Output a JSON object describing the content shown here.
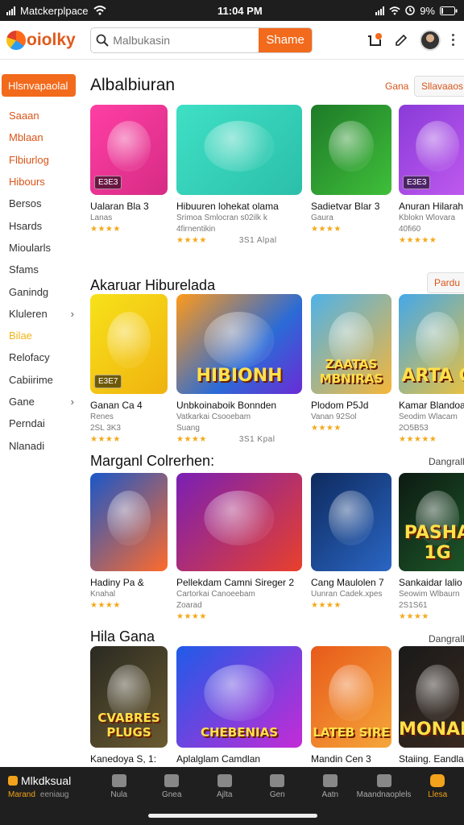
{
  "status": {
    "carrier": "Matckerplpace",
    "time": "11:04 PM",
    "battery": "9%"
  },
  "topbar": {
    "logo_text": "oiolky",
    "search_placeholder": "Malbukasin",
    "search_button": "Shame"
  },
  "sidebar": {
    "active": "Hlsnvapaolal",
    "items": [
      {
        "label": "Saaan",
        "style": "orange",
        "chevron": false
      },
      {
        "label": "Mblaan",
        "style": "orange",
        "chevron": false
      },
      {
        "label": "Flbiurlog",
        "style": "orange",
        "chevron": false
      },
      {
        "label": "Hibours",
        "style": "orange",
        "chevron": false
      },
      {
        "label": "Bersos",
        "style": "",
        "chevron": false
      },
      {
        "label": "Hsards",
        "style": "",
        "chevron": false
      },
      {
        "label": "Mioularls",
        "style": "",
        "chevron": false
      },
      {
        "label": "Sfams",
        "style": "",
        "chevron": false
      },
      {
        "label": "Ganindg",
        "style": "",
        "chevron": false
      },
      {
        "label": "Kluleren",
        "style": "",
        "chevron": true
      },
      {
        "label": "Bilae",
        "style": "yellow",
        "chevron": false
      },
      {
        "label": "Relofacy",
        "style": "",
        "chevron": false
      },
      {
        "label": "Cabiirime",
        "style": "",
        "chevron": false
      },
      {
        "label": "Gane",
        "style": "",
        "chevron": true
      },
      {
        "label": "Perndai",
        "style": "",
        "chevron": false
      },
      {
        "label": "Nlanadi",
        "style": "",
        "chevron": false
      }
    ]
  },
  "sections": [
    {
      "title": "Albalbiuran",
      "right_link": "Gana",
      "right_button": "Sllavaaos",
      "cards": [
        {
          "title": "Ualaran Bla 3",
          "sub1": "Lanas",
          "sub2": "",
          "stars": "★★★★",
          "meta": "",
          "tag": "E3E3",
          "bigtext": ""
        },
        {
          "title": "Hibuuren lohekat olama",
          "sub1": "Srimoa Smlocran s02ilk k",
          "sub2": "4firnentikin",
          "stars": "★★★★",
          "meta": "3S1 Alpal",
          "tag": "",
          "bigtext": ""
        },
        {
          "title": "Sadietvar Blar 3",
          "sub1": "Gaura",
          "sub2": "",
          "stars": "★★★★",
          "meta": "",
          "tag": "",
          "bigtext": ""
        },
        {
          "title": "Anuran Hilarah",
          "sub1": "Kblokn Wlovara",
          "sub2": "40fi60",
          "stars": "★★★★★",
          "meta": "",
          "tag": "E3E3",
          "bigtext": ""
        }
      ]
    },
    {
      "title": "Akaruar Hiburelada",
      "right_link": "",
      "right_button": "Pardu",
      "cards": [
        {
          "title": "Ganan Ca 4",
          "sub1": "Renes",
          "sub2": "2SL 3K3",
          "stars": "★★★★",
          "meta": "",
          "tag": "E3E7",
          "bigtext": ""
        },
        {
          "title": "Unbkoinaboik Bonnden",
          "sub1": "Vatkarkai Csooebam",
          "sub2": "Suang",
          "stars": "★★★★",
          "meta": "3S1 Kpal",
          "tag": "",
          "bigtext": "HIBIONH"
        },
        {
          "title": "Plodom P5Jd",
          "sub1": "Vanan 92Sol",
          "sub2": "",
          "stars": "★★★★",
          "meta": "",
          "tag": "",
          "bigtext": "ZAATAS MBNIRAS"
        },
        {
          "title": "Kamar Blandoar",
          "sub1": "Seodim Wlacam",
          "sub2": "2O5B53",
          "stars": "★★★★★",
          "meta": "",
          "tag": "",
          "bigtext": "ARTA G"
        }
      ]
    },
    {
      "title": "Marganl Colrerhen:",
      "right_link": "Dangrall",
      "right_button": "",
      "cards": [
        {
          "title": "Hadiny Pa &",
          "sub1": "Knahal",
          "sub2": "",
          "stars": "★★★★",
          "meta": "",
          "tag": "",
          "bigtext": ""
        },
        {
          "title": "Pellekdam Camni Sireger 2",
          "sub1": "Cartorkai Canoeebam",
          "sub2": "Zoarad",
          "stars": "★★★★",
          "meta": "",
          "tag": "",
          "bigtext": ""
        },
        {
          "title": "Cang Maulolen 7",
          "sub1": "Uunran Cadek.xpes",
          "sub2": "",
          "stars": "★★★★",
          "meta": "",
          "tag": "",
          "bigtext": ""
        },
        {
          "title": "Sankaidar lalio",
          "sub1": "Seowim Wlbaurn",
          "sub2": "2S1S61",
          "stars": "★★★★",
          "meta": "",
          "tag": "",
          "bigtext": "PASHA 1G"
        }
      ]
    },
    {
      "title": "Hila Gana",
      "right_link": "Dangrall",
      "right_button": "",
      "cards": [
        {
          "title": "Kanedoya S, 1:",
          "sub1": "",
          "sub2": "",
          "stars": "",
          "meta": "",
          "tag": "",
          "bigtext": "CVABRES PLUGS"
        },
        {
          "title": "Aplalglam Camdlan",
          "sub1": "",
          "sub2": "",
          "stars": "",
          "meta": "",
          "tag": "",
          "bigtext": "CHEBENIAS"
        },
        {
          "title": "Mandin Cen 3",
          "sub1": "",
          "sub2": "",
          "stars": "",
          "meta": "",
          "tag": "",
          "bigtext": "LATEB SIRE"
        },
        {
          "title": "Staiing. Eandlar",
          "sub1": "",
          "sub2": "",
          "stars": "",
          "meta": "",
          "tag": "",
          "bigtext": "MONARA"
        }
      ]
    }
  ],
  "bottomnav": {
    "active_label": "Mlkdksual",
    "active_sub": "Marand",
    "active_sub2": "eeniaug",
    "items": [
      "Nula",
      "Gnea",
      "Ajlta",
      "Gen",
      "Aatn",
      "Maandnaoplels",
      "Llesa"
    ]
  }
}
